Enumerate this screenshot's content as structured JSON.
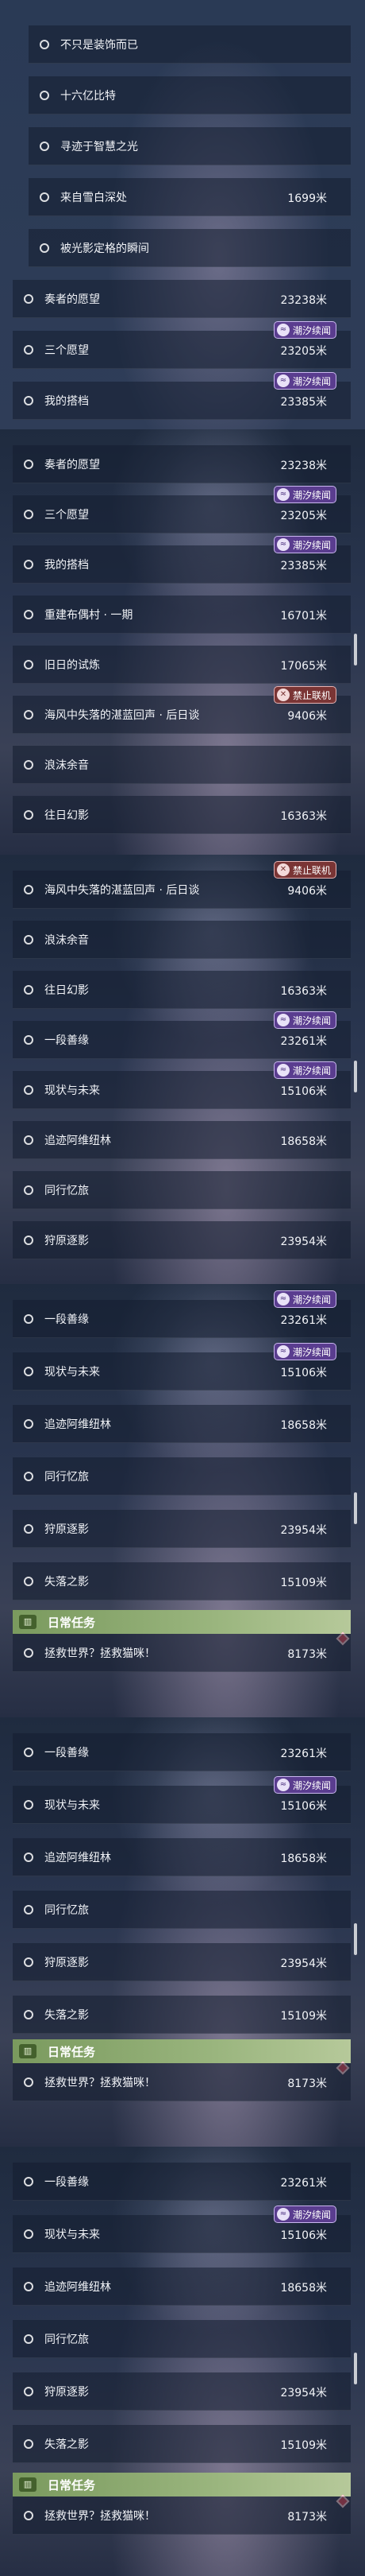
{
  "dist_unit": "米",
  "top_list": [
    {
      "name": "不只是装饰而已"
    },
    {
      "name": "十六亿比特"
    },
    {
      "name": "寻迹于智慧之光"
    },
    {
      "name": "来自雪白深处",
      "distance": "1699"
    },
    {
      "name": "被光影定格的瞬间"
    },
    {
      "name": "奏者的愿望",
      "distance": "23238"
    },
    {
      "name": "三个愿望",
      "distance": "23205",
      "badge": "潮汐续闻"
    },
    {
      "name": "我的搭档",
      "distance": "23385",
      "badge": "潮汐续闻"
    }
  ],
  "list2": [
    {
      "name": "奏者的愿望",
      "distance": "23238"
    },
    {
      "name": "三个愿望",
      "distance": "23205",
      "badge": "潮汐续闻"
    },
    {
      "name": "我的搭档",
      "distance": "23385",
      "badge": "潮汐续闻"
    },
    {
      "name": "重建布偶村 · 一期",
      "distance": "16701"
    },
    {
      "name": "旧日的试炼",
      "distance": "17065"
    },
    {
      "name": "海风中失落的湛蓝回声 · 后日谈",
      "distance": "9406",
      "badge_ban": "禁止联机"
    },
    {
      "name": "浪沫余音"
    },
    {
      "name": "往日幻影",
      "distance": "16363"
    }
  ],
  "list3": [
    {
      "name": "海风中失落的湛蓝回声 · 后日谈",
      "distance": "9406",
      "badge_ban": "禁止联机"
    },
    {
      "name": "浪沫余音"
    },
    {
      "name": "往日幻影",
      "distance": "16363"
    },
    {
      "name": "一段善缘",
      "distance": "23261",
      "badge": "潮汐续闻"
    },
    {
      "name": "现状与未来",
      "distance": "15106",
      "badge": "潮汐续闻"
    },
    {
      "name": "追迹阿维纽林",
      "distance": "18658"
    },
    {
      "name": "同行忆旅"
    },
    {
      "name": "狩原逐影",
      "distance": "23954"
    }
  ],
  "list4": [
    {
      "name": "一段善缘",
      "distance": "23261",
      "badge": "潮汐续闻"
    },
    {
      "name": "现状与未来",
      "distance": "15106",
      "badge": "潮汐续闻"
    },
    {
      "name": "追迹阿维纽林",
      "distance": "18658"
    },
    {
      "name": "同行忆旅"
    },
    {
      "name": "狩原逐影",
      "distance": "23954"
    },
    {
      "name": "失落之影",
      "distance": "15109"
    }
  ],
  "list5": [
    {
      "name": "一段善缘",
      "distance": "23261"
    },
    {
      "name": "现状与未来",
      "distance": "15106",
      "badge": "潮汐续闻"
    },
    {
      "name": "追迹阿维纽林",
      "distance": "18658"
    },
    {
      "name": "同行忆旅"
    },
    {
      "name": "狩原逐影",
      "distance": "23954"
    },
    {
      "name": "失落之影",
      "distance": "15109"
    }
  ],
  "list6": [
    {
      "name": "一段善缘",
      "distance": "23261"
    },
    {
      "name": "现状与未来",
      "distance": "15106",
      "badge": "潮汐续闻"
    },
    {
      "name": "追迹阿维纽林",
      "distance": "18658"
    },
    {
      "name": "同行忆旅"
    },
    {
      "name": "狩原逐影",
      "distance": "23954"
    },
    {
      "name": "失落之影",
      "distance": "15109"
    }
  ],
  "daily": {
    "label": "日常任务",
    "task": {
      "name": "拯救世界？拯救猫咪！",
      "distance": "8173"
    }
  }
}
